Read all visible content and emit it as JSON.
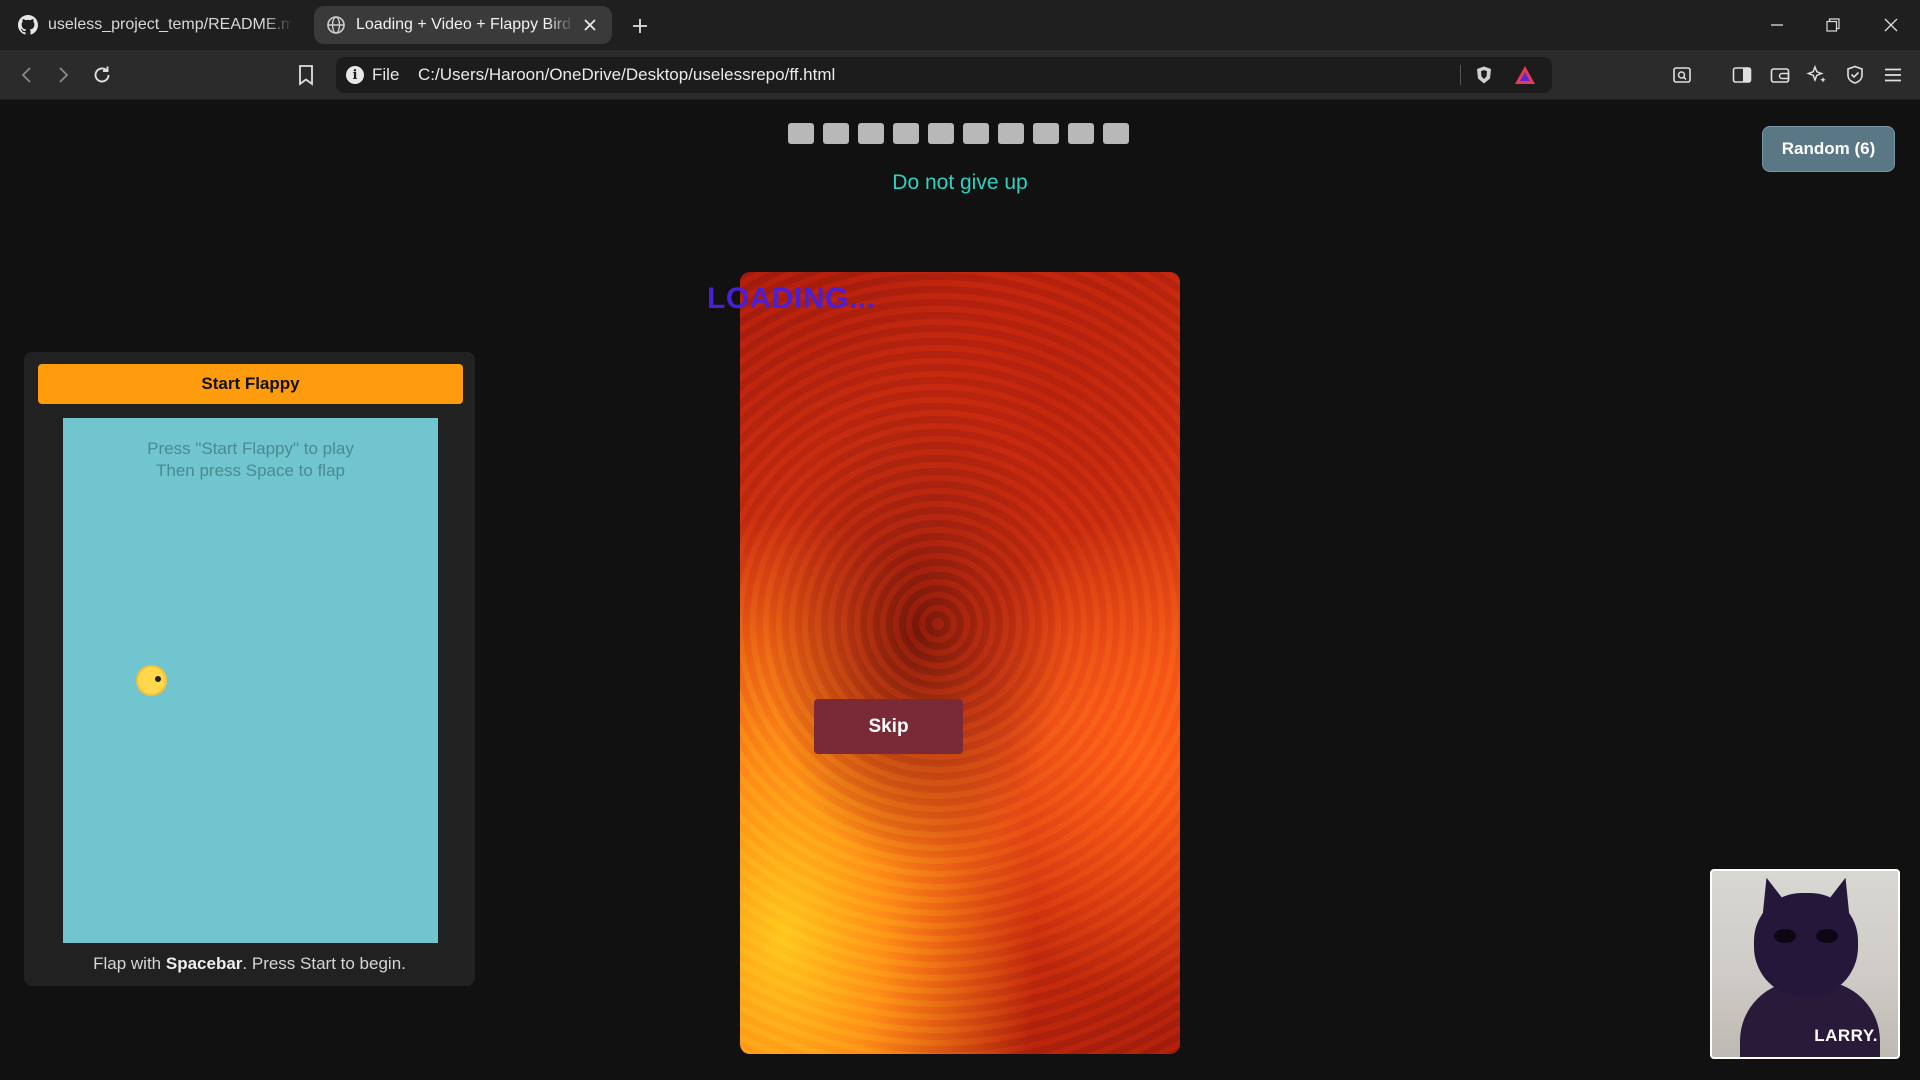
{
  "browser": {
    "tabs": [
      {
        "title": "useless_project_temp/README.md at main",
        "icon": "github-icon",
        "active": false
      },
      {
        "title": "Loading + Video + Flappy Bird + Random",
        "icon": "globe-icon",
        "active": true
      }
    ],
    "address": {
      "scheme_label": "File",
      "url": "C:/Users/Haroon/OneDrive/Desktop/uselessrepo/ff.html"
    }
  },
  "page": {
    "progress_segments": 10,
    "progress_filled": 10,
    "motivation_text": "Do not give up",
    "random_button_label": "Random (6)",
    "loading_text": "LOADING...",
    "flappy": {
      "start_button_label": "Start Flappy",
      "instruction_line1": "Press \"Start Flappy\" to play",
      "instruction_line2": "Then press Space to flap",
      "hint_prefix": "Flap with ",
      "hint_key": "Spacebar",
      "hint_suffix": ". Press Start to begin."
    },
    "video": {
      "skip_button_label": "Skip"
    },
    "cat_overlay_label": "LARRY."
  },
  "colors": {
    "accent_teal": "#2fd1c2",
    "start_orange": "#ff9c0d",
    "sky_blue": "#70c5ce",
    "loading_purple": "#4b1fd6",
    "skip_maroon": "#7a2a36",
    "random_slate": "#5a7786"
  }
}
